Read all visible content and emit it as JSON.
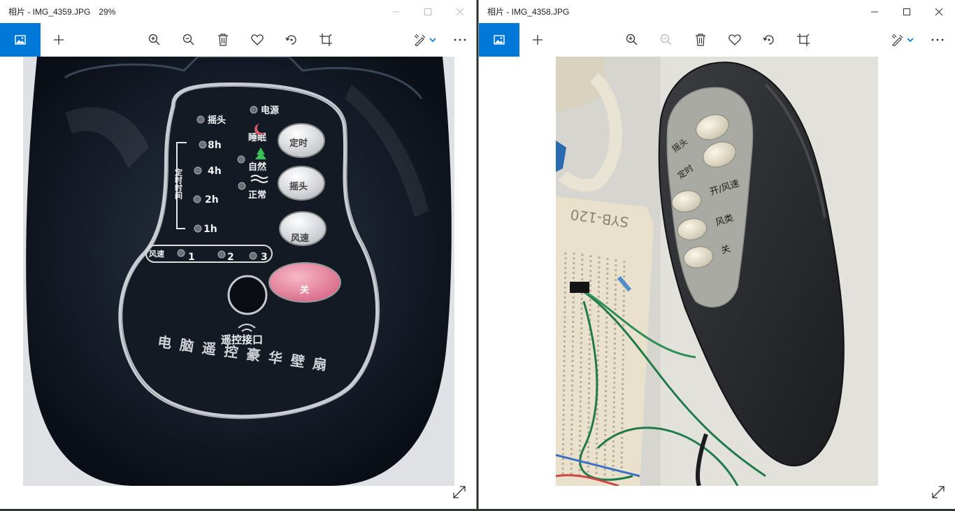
{
  "windows": [
    {
      "id": "left",
      "title": "相片 - IMG_4359.JPG",
      "zoom": "29%",
      "toolbar": {
        "home_icon": "picture-icon",
        "add_icon": "plus-icon",
        "buttons": [
          "zoom-in-icon",
          "zoom-out-icon",
          "delete-icon",
          "favorite-icon",
          "rotate-icon",
          "crop-icon"
        ],
        "edit_icon": "edit-draw-icon",
        "more_icon": "more-icon"
      },
      "photo": {
        "panel_labels": {
          "power": "电源",
          "swing": "摇头",
          "sleep": "睡眠",
          "natural": "自然",
          "normal": "正常",
          "timer_vertical": "定时时间",
          "t8": "8h",
          "t4": "4h",
          "t2": "2h",
          "t1": "1h",
          "speed": "风速",
          "s1": "1",
          "s2": "2",
          "s3": "3",
          "btn_timer": "定时",
          "btn_swing": "摇头",
          "btn_speed": "风速",
          "btn_off": "关",
          "remote_port": "遥控接口",
          "brand": "电脑遥控豪华壁扇"
        }
      }
    },
    {
      "id": "right",
      "title": "相片 - IMG_4358.JPG",
      "zoom": "",
      "toolbar": {
        "home_icon": "picture-icon",
        "add_icon": "plus-icon",
        "buttons": [
          "zoom-in-icon",
          "zoom-out-icon",
          "delete-icon",
          "favorite-icon",
          "rotate-icon",
          "crop-icon"
        ],
        "edit_icon": "edit-draw-icon",
        "more_icon": "more-icon"
      },
      "photo": {
        "remote_labels": {
          "swing": "摇头",
          "timer": "定时",
          "on_speed": "开/风速",
          "wind_type": "风类",
          "off": "关"
        },
        "breadboard_label": "SYB-120"
      }
    }
  ],
  "colors": {
    "accent": "#0078d7",
    "toolbar_icon": "#333333",
    "disabled_icon": "#bdbdbd"
  }
}
